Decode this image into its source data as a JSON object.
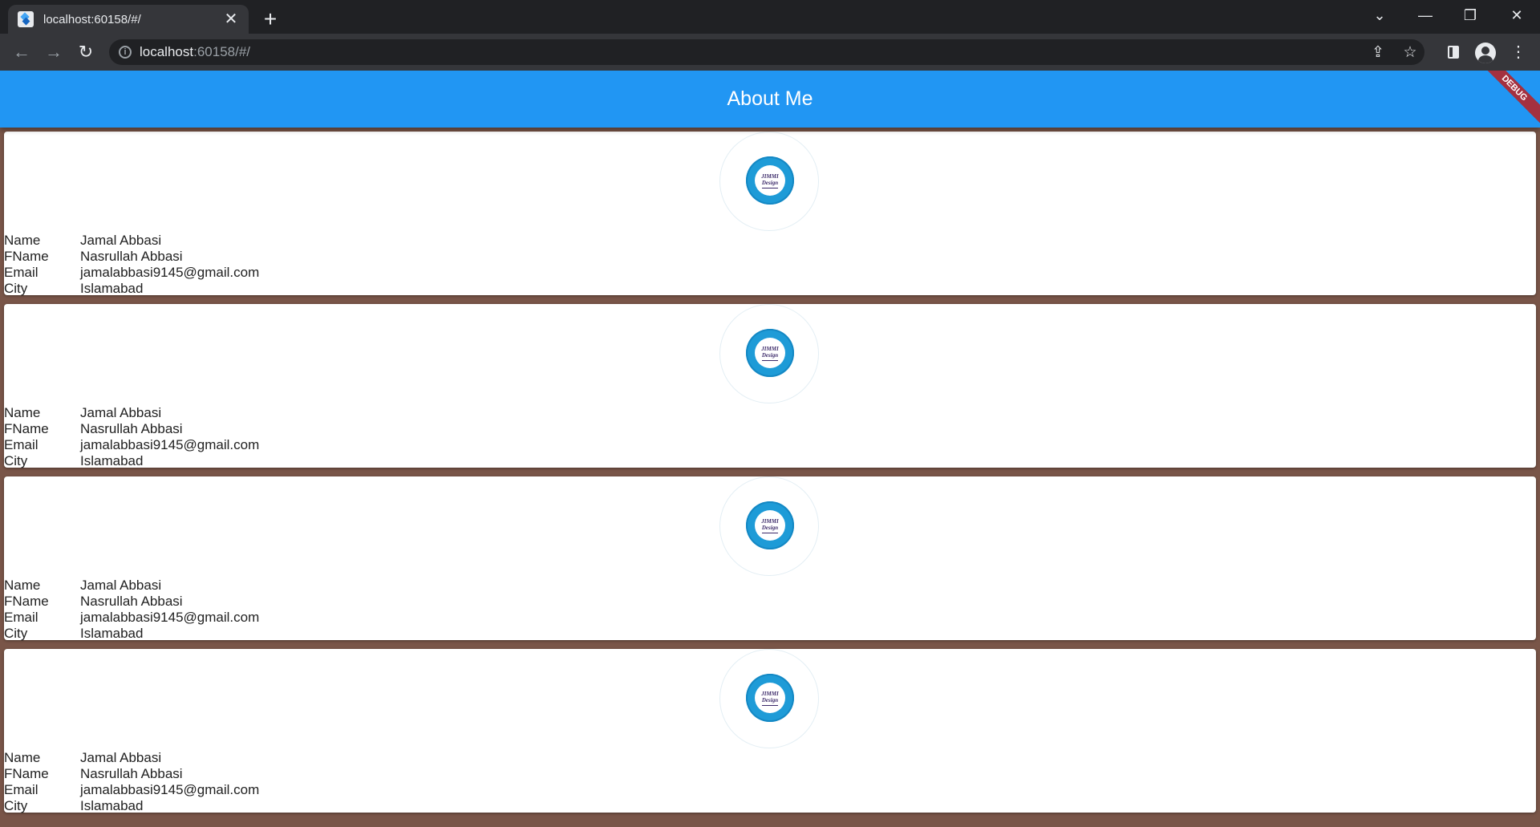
{
  "browser": {
    "tab_title": "localhost:60158/#/",
    "url_host": "localhost",
    "url_rest": ":60158/#/"
  },
  "app": {
    "title": "About Me",
    "debug_label": "DEBUG",
    "colors": {
      "appbar": "#2196f3",
      "background": "#795548",
      "card": "#ffffff",
      "debug_banner": "#a4303f"
    },
    "labels": {
      "name": "Name",
      "fname": "FName",
      "email": "Email",
      "city": "City"
    },
    "logo_text": [
      "JIMMI",
      "Design"
    ],
    "cards": [
      {
        "name": "Jamal Abbasi",
        "fname": "Nasrullah Abbasi",
        "email": "jamalabbasi9145@gmail.com",
        "city": "Islamabad"
      },
      {
        "name": "Jamal Abbasi",
        "fname": "Nasrullah Abbasi",
        "email": "jamalabbasi9145@gmail.com",
        "city": "Islamabad"
      },
      {
        "name": "Jamal Abbasi",
        "fname": "Nasrullah Abbasi",
        "email": "jamalabbasi9145@gmail.com",
        "city": "Islamabad"
      },
      {
        "name": "Jamal Abbasi",
        "fname": "Nasrullah Abbasi",
        "email": "jamalabbasi9145@gmail.com",
        "city": "Islamabad"
      }
    ]
  },
  "icons": {
    "back": "arrow-left-icon",
    "forward": "arrow-right-icon",
    "reload": "reload-icon",
    "site_info": "info-icon",
    "share": "share-icon",
    "bookmark": "star-icon",
    "side_panel": "side-panel-icon",
    "profile": "profile-icon",
    "menu": "kebab-menu-icon"
  }
}
